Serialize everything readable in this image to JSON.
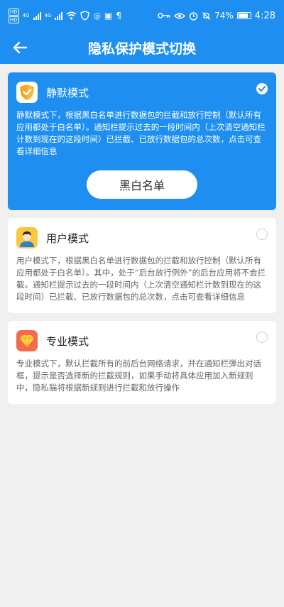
{
  "status_bar": {
    "hd_1": "HD",
    "hd_2": "HD",
    "net_1": "4G",
    "net_2": "4G",
    "battery": "74%",
    "time": "4:28"
  },
  "header": {
    "title": "隐私保护模式切换"
  },
  "modes": [
    {
      "title": "静默模式",
      "selected": true,
      "icon": "shield-icon",
      "description": "静默模式下，根据黑白名单进行数据包的拦截和放行控制（默认所有应用都处于白名单）。通知栏提示过去的一段时间内（上次清空通知栏计数到现在的这段时间）已拦截、已放行数据包的总次数，点击可查看详细信息",
      "button_label": "黑白名单"
    },
    {
      "title": "用户模式",
      "selected": false,
      "icon": "user-avatar-icon",
      "description": "用户模式下，根据黑白名单进行数据包的拦截和放行控制（默认所有应用都处于白名单）。其中，处于“后台放行例外”的后台应用将不会拦截。通知栏提示过去的一段时间内（上次清空通知栏计数到现在的这段时间）已拦截、已放行数据包的总次数，点击可查看详细信息"
    },
    {
      "title": "专业模式",
      "selected": false,
      "icon": "diamond-icon",
      "description": "专业模式下，默认拦截所有的前后台网络请求，并在通知栏弹出对话框，提示是否选择新的拦截规则，如果手动将具体应用加入新规则中，隐私猫将根据新规则进行拦截和放行操作"
    }
  ],
  "colors": {
    "primary": "#1e8ff1",
    "background": "#f0f0f0",
    "shield": "#f5a623",
    "user_icon_bg": "#f8c93c",
    "diamond_icon_bg": "#f26b4a"
  }
}
